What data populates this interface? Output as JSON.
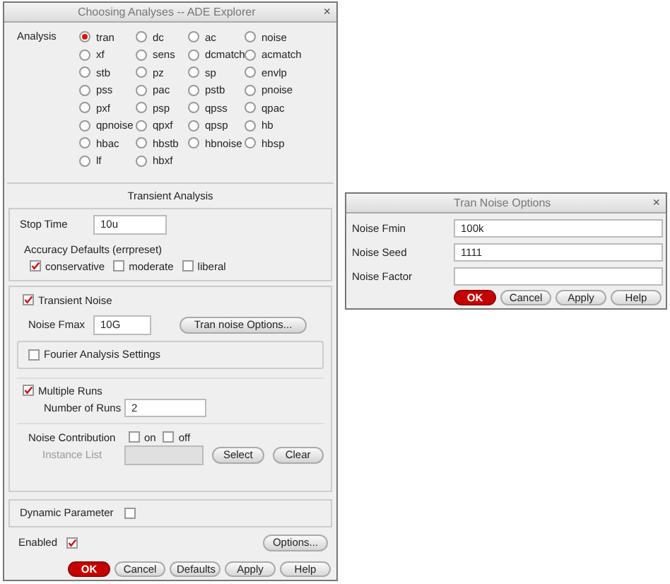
{
  "main_window": {
    "title": "Choosing Analyses -- ADE Explorer",
    "close": "×",
    "analysis": {
      "label": "Analysis",
      "options": [
        {
          "label": "tran",
          "selected": true
        },
        {
          "label": "dc",
          "selected": false
        },
        {
          "label": "ac",
          "selected": false
        },
        {
          "label": "noise",
          "selected": false
        },
        {
          "label": "xf",
          "selected": false
        },
        {
          "label": "sens",
          "selected": false
        },
        {
          "label": "dcmatch",
          "selected": false
        },
        {
          "label": "acmatch",
          "selected": false
        },
        {
          "label": "stb",
          "selected": false
        },
        {
          "label": "pz",
          "selected": false
        },
        {
          "label": "sp",
          "selected": false
        },
        {
          "label": "envlp",
          "selected": false
        },
        {
          "label": "pss",
          "selected": false
        },
        {
          "label": "pac",
          "selected": false
        },
        {
          "label": "pstb",
          "selected": false
        },
        {
          "label": "pnoise",
          "selected": false
        },
        {
          "label": "pxf",
          "selected": false
        },
        {
          "label": "psp",
          "selected": false
        },
        {
          "label": "qpss",
          "selected": false
        },
        {
          "label": "qpac",
          "selected": false
        },
        {
          "label": "qpnoise",
          "selected": false
        },
        {
          "label": "qpxf",
          "selected": false
        },
        {
          "label": "qpsp",
          "selected": false
        },
        {
          "label": "hb",
          "selected": false
        },
        {
          "label": "hbac",
          "selected": false
        },
        {
          "label": "hbstb",
          "selected": false
        },
        {
          "label": "hbnoise",
          "selected": false
        },
        {
          "label": "hbsp",
          "selected": false
        },
        {
          "label": "lf",
          "selected": false
        },
        {
          "label": "hbxf",
          "selected": false
        }
      ]
    },
    "transient": {
      "heading": "Transient Analysis",
      "stop_time": {
        "label": "Stop Time",
        "value": "10u"
      },
      "accuracy": {
        "label": "Accuracy Defaults (errpreset)",
        "options": [
          {
            "label": "conservative",
            "checked": true
          },
          {
            "label": "moderate",
            "checked": false
          },
          {
            "label": "liberal",
            "checked": false
          }
        ]
      },
      "transient_noise": {
        "label": "Transient Noise",
        "checked": true
      },
      "noise_fmax": {
        "label": "Noise Fmax",
        "value": "10G"
      },
      "options_button": "Tran noise Options...",
      "fourier": {
        "label": "Fourier Analysis Settings",
        "checked": false
      },
      "multiple_runs": {
        "label": "Multiple Runs",
        "checked": true
      },
      "number_of_runs": {
        "label": "Number of Runs",
        "value": "2"
      },
      "noise_contribution": {
        "label": "Noise Contribution",
        "options": [
          {
            "label": "on",
            "checked": false
          },
          {
            "label": "off",
            "checked": false
          }
        ]
      },
      "instance_list": {
        "label": "Instance List",
        "disabled": true
      },
      "list_buttons": [
        "Select",
        "Clear"
      ]
    },
    "dynamic_parameter": {
      "label": "Dynamic Parameter",
      "checked": false
    },
    "enabled": {
      "label": "Enabled",
      "checked": true
    },
    "options_button": "Options...",
    "buttons": [
      {
        "label": "OK",
        "kind": "primary"
      },
      {
        "label": "Cancel",
        "kind": "normal"
      },
      {
        "label": "Defaults",
        "kind": "normal"
      },
      {
        "label": "Apply",
        "kind": "normal"
      },
      {
        "label": "Help",
        "kind": "normal"
      }
    ]
  },
  "noise_window": {
    "title": "Tran Noise Options",
    "close": "×",
    "fields": [
      {
        "label": "Noise Fmin",
        "value": "100k"
      },
      {
        "label": "Noise Seed",
        "value": "1111"
      },
      {
        "label": "Noise Factor"
      }
    ],
    "buttons": [
      {
        "label": "OK",
        "kind": "primary"
      },
      {
        "label": "Cancel",
        "kind": "normal"
      },
      {
        "label": "Apply",
        "kind": "normal"
      },
      {
        "label": "Help",
        "kind": "normal"
      }
    ]
  }
}
